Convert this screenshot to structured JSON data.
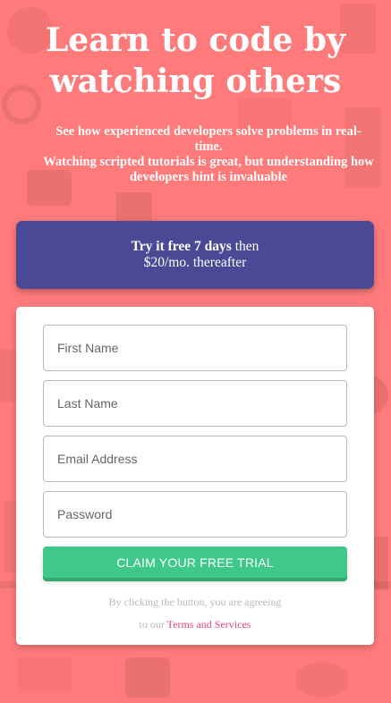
{
  "hero": {
    "title": "Learn to code by watching others",
    "subtitle_line1": "See how experienced developers solve problems in real-time.",
    "subtitle_line2": "Watching scripted tutorials is great, but understanding how developers hint is invaluable"
  },
  "promo": {
    "bold_text": "Try it free 7 days",
    "rest_text": " then",
    "price_text": "$20/mo. thereafter"
  },
  "form": {
    "first_name_placeholder": "First Name",
    "last_name_placeholder": "Last Name",
    "email_placeholder": "Email Address",
    "password_placeholder": "Password",
    "claim_label": "CLAIM YOUR FREE TRIAL",
    "terms_line1": "By clicking the button, you are agreeing",
    "terms_prefix": "to our ",
    "terms_link": "Terms and Services"
  },
  "colors": {
    "background": "#ff7b7b",
    "promo_bg": "#4a4996",
    "button": "#3ec98a",
    "link": "#e2477e"
  }
}
